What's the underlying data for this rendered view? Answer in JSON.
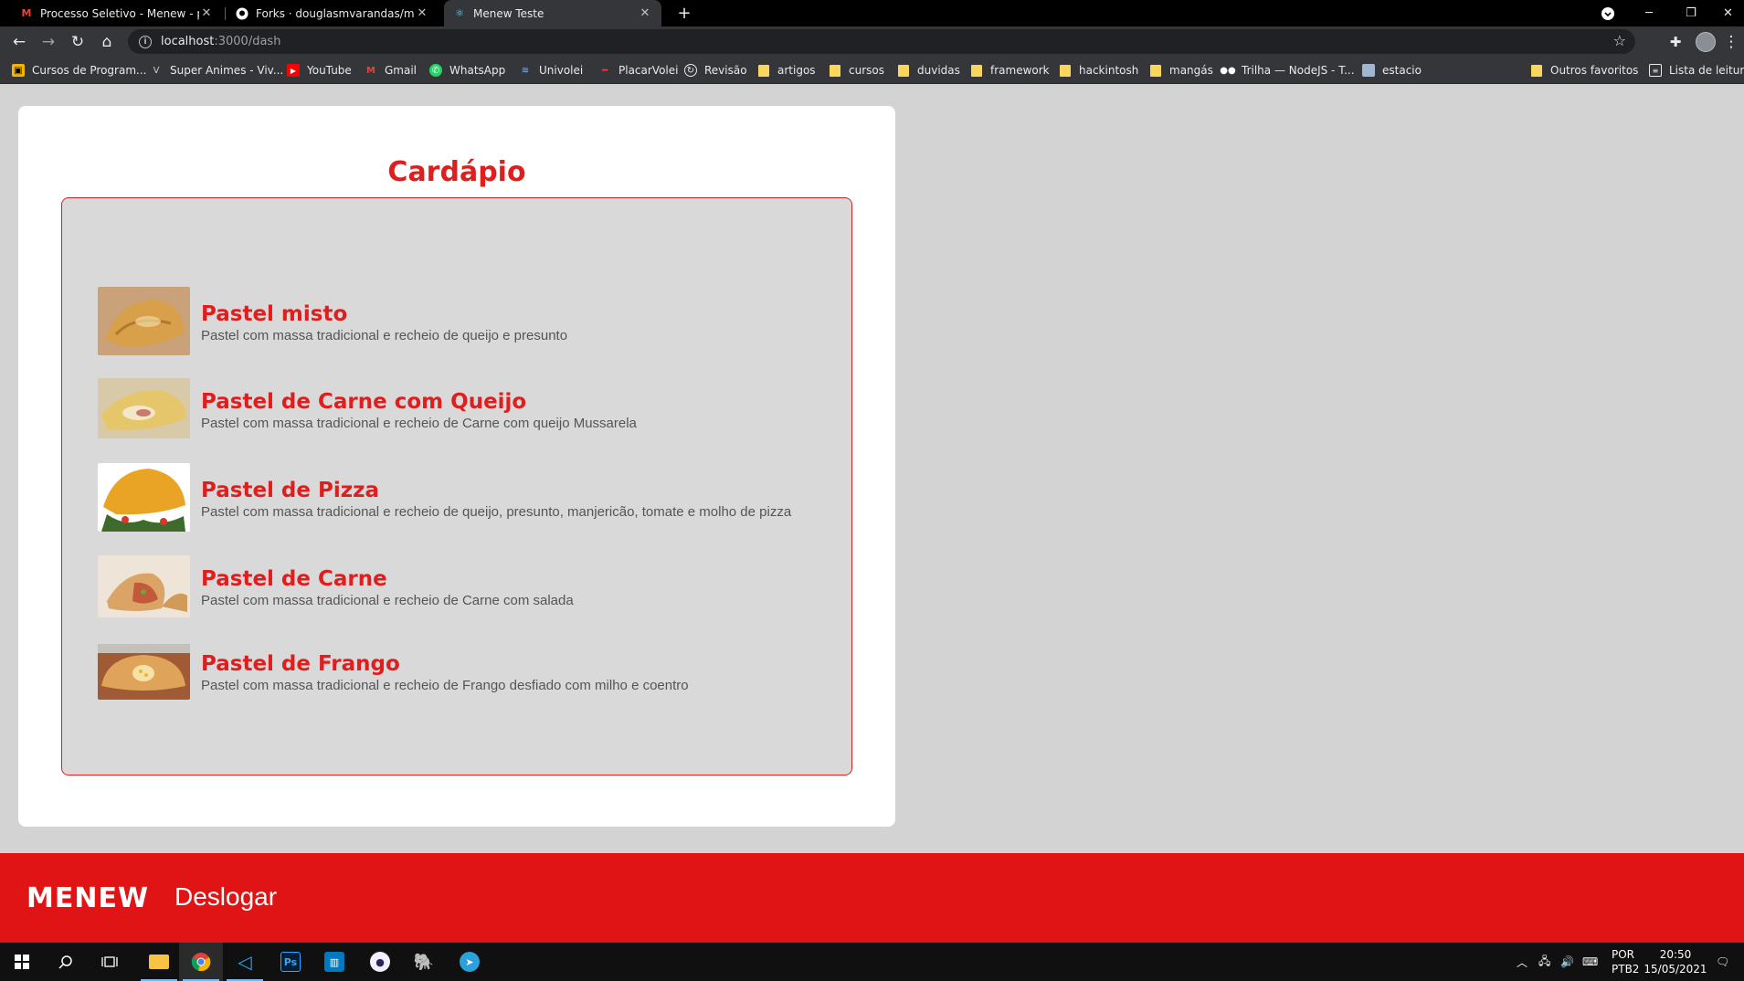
{
  "browser": {
    "tabs": [
      {
        "title": "Processo Seletivo - Menew - patr",
        "icon": "gmail-icon"
      },
      {
        "title": "Forks · douglasmvarandas/mene",
        "icon": "github-icon"
      },
      {
        "title": "Menew Teste",
        "icon": "react-icon"
      }
    ],
    "address": {
      "host": "localhost",
      "path": ":3000/dash"
    },
    "bookmarks": [
      {
        "label": "Cursos de Program..."
      },
      {
        "label": "Super Animes - Viv..."
      },
      {
        "label": "YouTube"
      },
      {
        "label": "Gmail"
      },
      {
        "label": "WhatsApp"
      },
      {
        "label": "Univolei"
      },
      {
        "label": "PlacarVolei"
      },
      {
        "label": "Revisão"
      },
      {
        "label": "artigos"
      },
      {
        "label": "cursos"
      },
      {
        "label": "duvidas"
      },
      {
        "label": "framework"
      },
      {
        "label": "hackintosh"
      },
      {
        "label": "mangás"
      },
      {
        "label": "Trilha — NodeJS - T..."
      },
      {
        "label": "estacio"
      }
    ],
    "other_bookmarks": "Outros favoritos",
    "reading_list": "Lista de leitura"
  },
  "page": {
    "title": "Cardápio",
    "items": [
      {
        "name": "Pastel misto",
        "description": "Pastel com massa tradicional e recheio de queijo e presunto"
      },
      {
        "name": "Pastel de Carne com Queijo",
        "description": "Pastel com massa tradicional e recheio de Carne com queijo Mussarela"
      },
      {
        "name": "Pastel de Pizza",
        "description": "Pastel com massa tradicional e recheio de queijo, presunto, manjericão, tomate e molho de pizza"
      },
      {
        "name": "Pastel de Carne",
        "description": "Pastel com massa tradicional e recheio de Carne com salada"
      },
      {
        "name": "Pastel de Frango",
        "description": "Pastel com massa tradicional e recheio de Frango desfiado com milho e coentro"
      }
    ]
  },
  "footer": {
    "logo": "MENEW",
    "logout_label": "Deslogar"
  },
  "taskbar": {
    "language": "POR",
    "layout": "PTB2",
    "time": "20:50",
    "date": "15/05/2021"
  },
  "colors": {
    "brand_red": "#e01414",
    "card_bg": "#ffffff",
    "menu_bg": "#d9d9d9"
  }
}
